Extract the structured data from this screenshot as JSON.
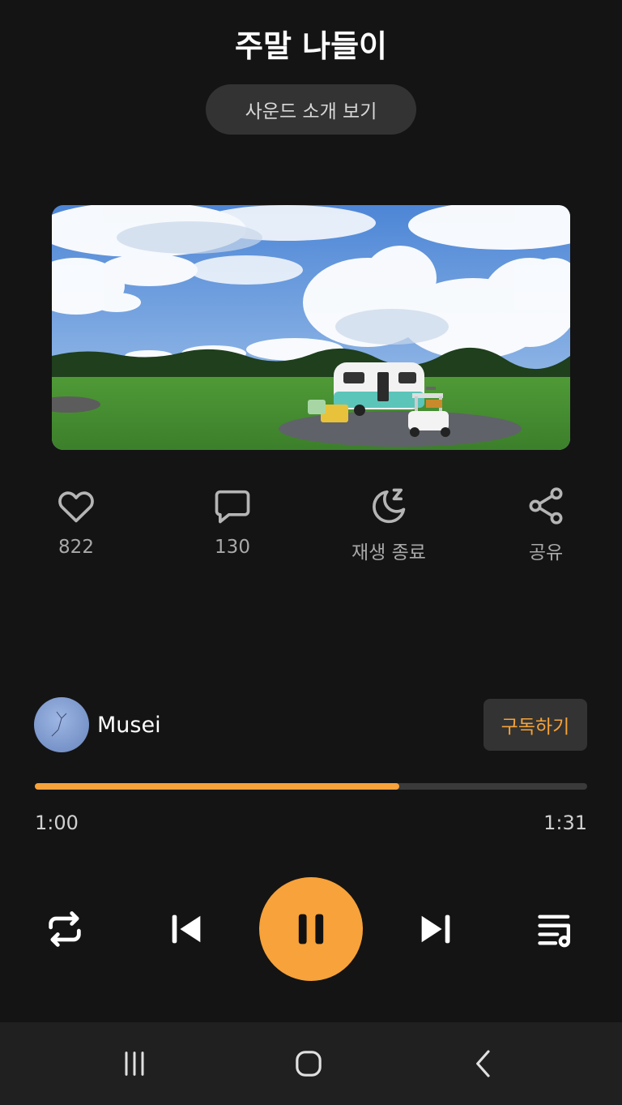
{
  "header": {
    "title": "주말 나들이",
    "intro_button_label": "사운드 소개 보기"
  },
  "cover": {
    "description_icon": "campervan-field-image"
  },
  "actions": [
    {
      "icon": "heart-icon",
      "label": "822"
    },
    {
      "icon": "comment-icon",
      "label": "130"
    },
    {
      "icon": "sleep-timer-icon",
      "label": "재생 종료"
    },
    {
      "icon": "share-icon",
      "label": "공유"
    }
  ],
  "creator": {
    "name": "Musei",
    "subscribe_label": "구독하기"
  },
  "player": {
    "current_time": "1:00",
    "total_time": "1:31",
    "progress": 0.66,
    "accent_color": "#f7a23a"
  },
  "controls": {
    "repeat": "repeat-icon",
    "previous": "skip-previous-icon",
    "play_pause": "pause-icon",
    "next": "skip-next-icon",
    "playlist": "playlist-icon"
  },
  "system_nav": {
    "recents": "recents-icon",
    "home": "home-icon",
    "back": "back-icon"
  }
}
